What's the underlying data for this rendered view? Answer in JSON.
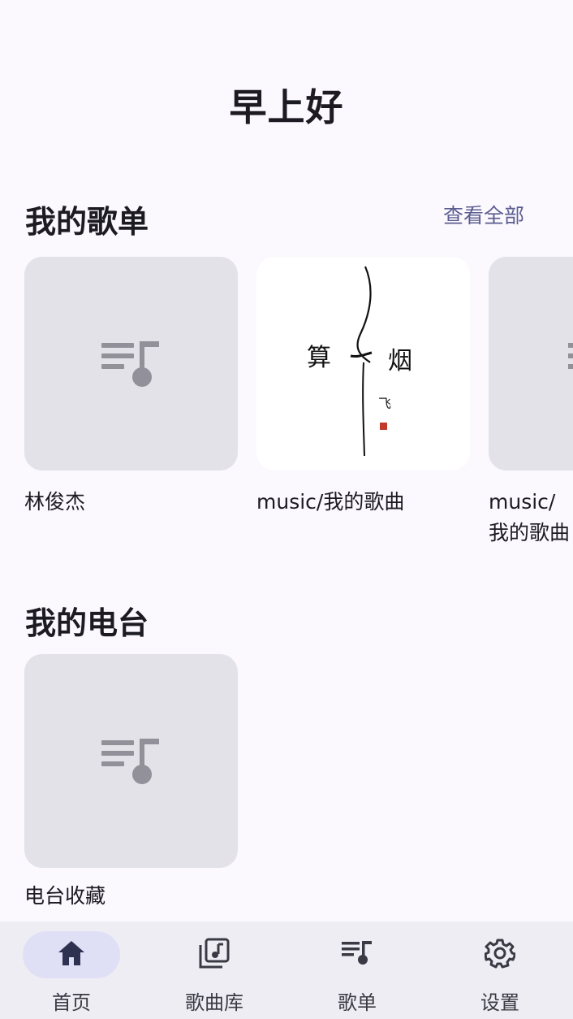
{
  "greeting": "早上好",
  "playlists": {
    "title": "我的歌单",
    "see_all": "查看全部",
    "items": [
      {
        "label": "林俊杰"
      },
      {
        "label": "music/我的歌曲"
      },
      {
        "label": "music/我的歌曲"
      }
    ]
  },
  "radio": {
    "title": "我的电台",
    "items": [
      {
        "label": "电台收藏"
      }
    ]
  },
  "nav": {
    "items": [
      {
        "label": "首页",
        "icon": "home-icon",
        "active": true
      },
      {
        "label": "歌曲库",
        "icon": "music-library-icon",
        "active": false
      },
      {
        "label": "歌单",
        "icon": "playlist-icon",
        "active": false
      },
      {
        "label": "设置",
        "icon": "settings-icon",
        "active": false
      }
    ]
  },
  "colors": {
    "background": "#fbf8fe",
    "cover_placeholder": "#e3e2e9",
    "accent": "#5b5d90",
    "nav_background": "#efedf4",
    "nav_active": "#dfe0f6"
  },
  "album_art_text": [
    "算",
    "烟",
    "飞"
  ]
}
